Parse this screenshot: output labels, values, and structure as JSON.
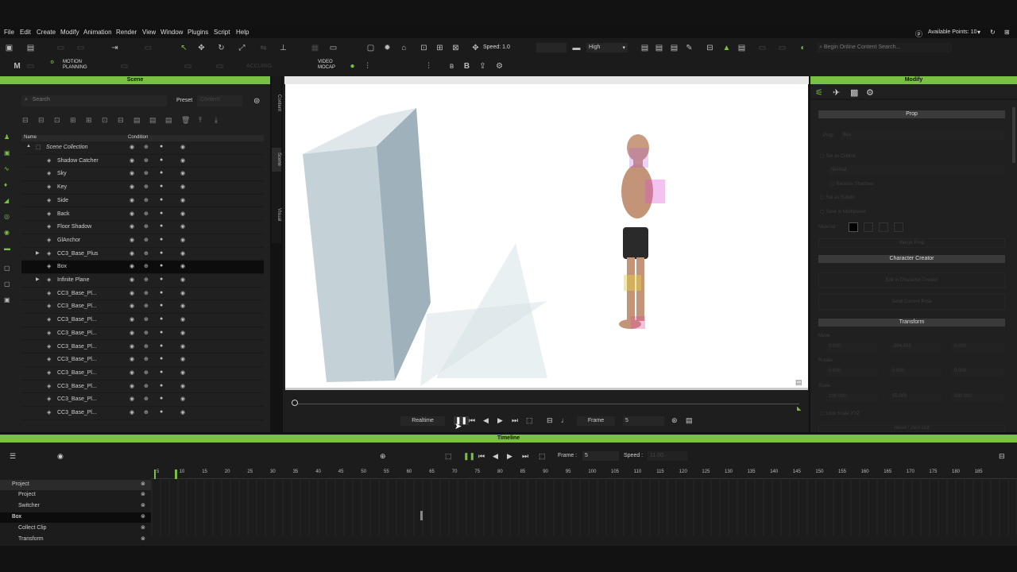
{
  "menu": [
    "File",
    "Edit",
    "Create",
    "Modify",
    "Animation",
    "Render",
    "View",
    "Window",
    "Plugins",
    "Script",
    "Help"
  ],
  "toolbar": {
    "speed": "Speed: 1.0",
    "quality": "High",
    "search_placeholder": "Begin Online Content Search...",
    "available_points": "Available Points: 10",
    "motion_planning": "MOTION\nPLANNING",
    "video_mocap": "VIDEO\nMOCAP",
    "accurig": "ACCURIG"
  },
  "scene": {
    "title": "Scene",
    "search_placeholder": "Search",
    "preset_label": "Preset",
    "preset_value": "Content",
    "col_name": "Name",
    "col_condition": "Condition",
    "tabs": [
      "Content",
      "Scene",
      "Visual"
    ],
    "rows": [
      "Scene Collection",
      "Shadow Catcher",
      "Sky",
      "Key",
      "Side",
      "Back",
      "Floor Shadow",
      "GlAnchor",
      "CC3_Base_Plus",
      "Box",
      "Infinite Plane",
      "CC3_Base_Pl...",
      "CC3_Base_Pl...",
      "CC3_Base_Pl...",
      "CC3_Base_Pl...",
      "CC3_Base_Pl...",
      "CC3_Base_Pl...",
      "CC3_Base_Pl...",
      "CC3_Base_Pl...",
      "CC3_Base_Pl...",
      "CC3_Base_Pl..."
    ]
  },
  "playback": {
    "realtime": "Realtime",
    "frame_label": "Frame",
    "frame_value": "5"
  },
  "modify": {
    "title": "Modify",
    "prop": "Prop",
    "prop_name": "Box",
    "cast_shadows": "Cast Shadows",
    "set_outline": "Set as Outline",
    "normal": "Normal",
    "set_subdiv": "Set as Subdiv",
    "save_in_moveset": "Save in Multipleset",
    "receive_shadows": "Receive Shadows",
    "material": "Material",
    "character_creator": "Character Creator",
    "edit_cc": "Edit in Character Creator",
    "send_cc": "Send Current Pose",
    "transform": "Transform",
    "move": "Move",
    "rotate": "Rotate",
    "scale": "Scale",
    "x_move": "0.000",
    "y_move": "-204.655",
    "z_move": "0.000",
    "x_rot": "0.000",
    "y_rot": "0.000",
    "z_rot": "0.000",
    "x_sc": "100.000",
    "y_sc": "55.000",
    "z_sc": "100.000",
    "lock_scale": "Lock Scale XYZ",
    "reset": "Reset / Zero Out",
    "merge_prop": "Merge Prop"
  },
  "timeline": {
    "title": "Timeline",
    "frame_label": "Frame :",
    "frame_value": "5",
    "speed_label": "Speed :",
    "speed_value": "11.00",
    "ticks": [
      "5",
      "10",
      "15",
      "20",
      "25",
      "30",
      "35",
      "40",
      "45",
      "50",
      "55",
      "60",
      "65",
      "70",
      "75",
      "80",
      "85",
      "90",
      "95",
      "100",
      "105",
      "110",
      "115",
      "120",
      "125",
      "130",
      "135",
      "140",
      "145",
      "150",
      "155",
      "160",
      "165",
      "170",
      "175",
      "180",
      "185"
    ],
    "tracks": [
      "Project",
      "Project",
      "Switcher",
      "Box",
      "Collect Clip",
      "Transform"
    ]
  },
  "colors": {
    "accent": "#7ac043",
    "panel": "#202020"
  }
}
